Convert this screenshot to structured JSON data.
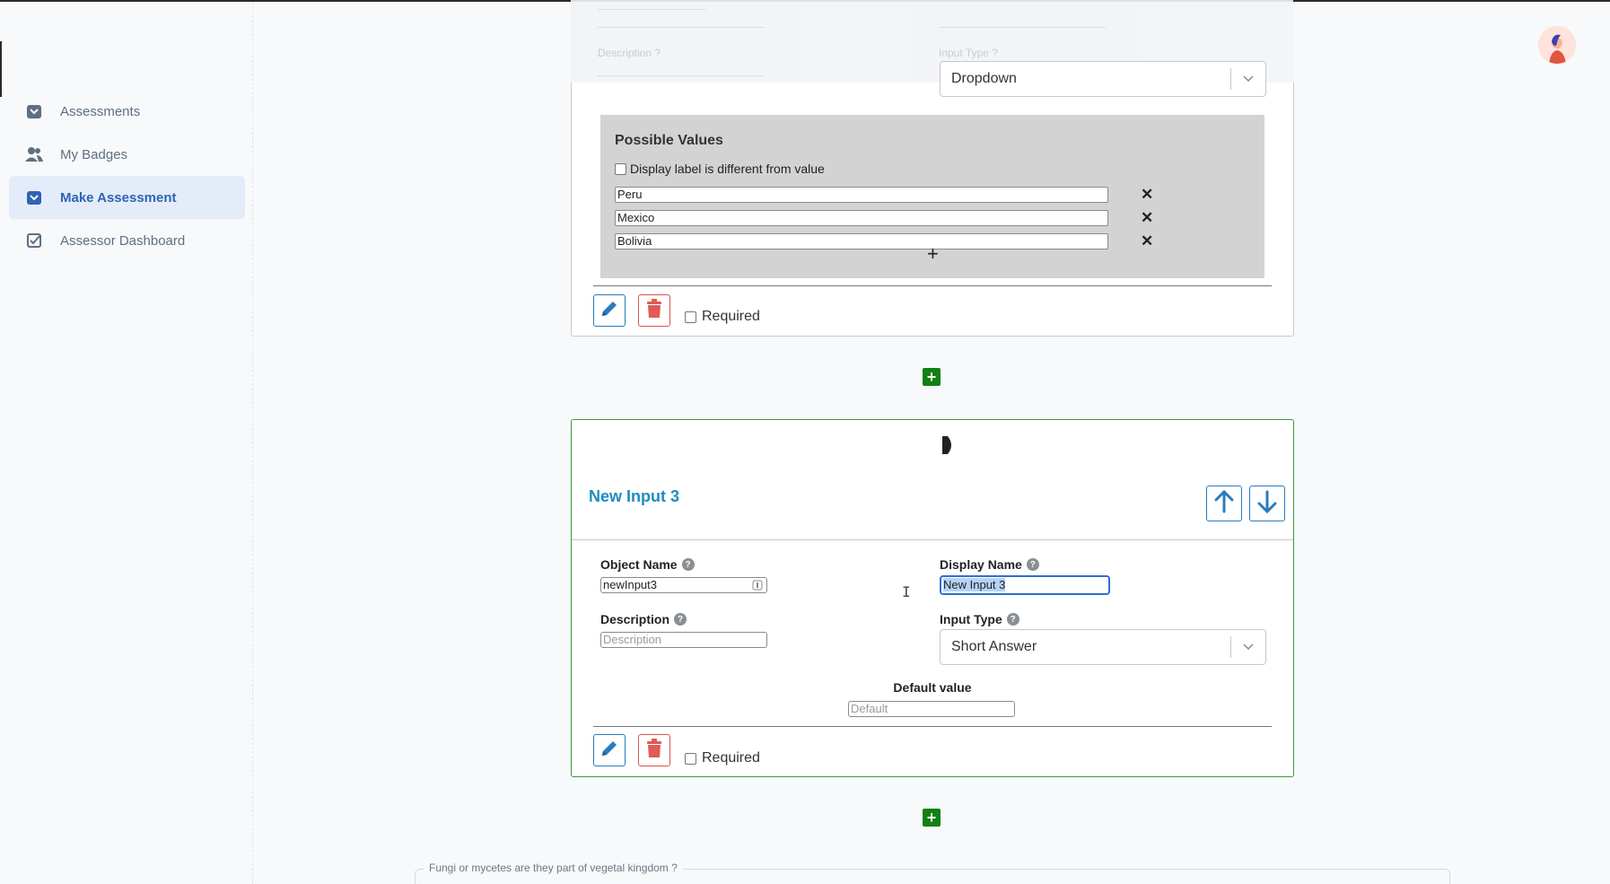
{
  "sidebar": {
    "items": [
      {
        "label": "Assessments",
        "icon": "assessment-icon",
        "active": false
      },
      {
        "label": "My Badges",
        "icon": "users-icon",
        "active": false
      },
      {
        "label": "Make Assessment",
        "icon": "assessment-icon",
        "active": true
      },
      {
        "label": "Assessor Dashboard",
        "icon": "checkbox-icon",
        "active": false
      }
    ]
  },
  "colors": {
    "accent_blue": "#2f64b4",
    "title_blue": "#1f8cbf",
    "active_bg": "#e3ecf8",
    "add_green": "#138013",
    "delete_red": "#d9534f",
    "card_border_active": "#3a9a3a"
  },
  "card1": {
    "input_type_value": "Dropdown",
    "possible_values_title": "Possible Values",
    "display_label_checkbox": "Display label is different from value",
    "values": [
      "Peru",
      "Mexico",
      "Bolivia"
    ],
    "add_value_symbol": "+",
    "remove_symbol": "✕",
    "required_label": "Required"
  },
  "card2": {
    "title": "New Input 3",
    "object_name_label": "Object Name",
    "object_name_value": "newInput3",
    "display_name_label": "Display Name",
    "display_name_value": "New Input 3",
    "description_label": "Description",
    "description_placeholder": "Description",
    "input_type_label": "Input Type",
    "input_type_value": "Short Answer",
    "default_value_label": "Default value",
    "default_placeholder": "Default",
    "required_label": "Required"
  },
  "add_symbol": "+",
  "footer": {
    "question_legend": "Fungi or mycetes are they part of vegetal kingdom ?"
  }
}
